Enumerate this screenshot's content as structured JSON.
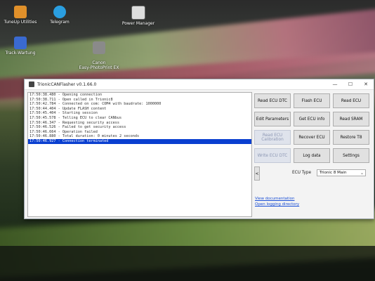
{
  "desktop": {
    "icons": [
      {
        "label": "TuneUp Utilities"
      },
      {
        "label": "Telegram"
      },
      {
        "label": "Power Manager"
      },
      {
        "label": "Track-Wartung"
      },
      {
        "label": "Canon\nEasy-PhotoPrint EX"
      }
    ]
  },
  "window": {
    "title": "TrionicCANFlasher v0.1.66.0",
    "controls": {
      "minimize": "—",
      "maximize": "☐",
      "close": "✕"
    }
  },
  "log": {
    "lines": [
      "17:50:38.480 - Opening connection",
      "17:50:38.711 - Open called in Trionic8",
      "17:50:42.784 - Connected on com: COM4 with baudrate: 1000000",
      "17:50:44.404 - Update FLASH content",
      "17:50:45.404 - Starting session",
      "17:50:45.578 - Telling ECU to clear CANbus",
      "17:50:46.347 - Requesting security access",
      "17:50:46.526 - Failed to get security access",
      "17:50:46.664 - Operation failed",
      "17:50:46.880 - Total duration: 0 minutes 2 seconds",
      "17:50:46.927 - Connection terminated"
    ],
    "selected_index": 10
  },
  "buttons": {
    "read_ecu_dtc": "Read ECU DTC",
    "flash_ecu": "Flash ECU",
    "read_ecu": "Read ECU",
    "edit_parameters": "Edit Parameters",
    "get_ecu_info": "Get ECU info",
    "read_sram": "Read SRAM",
    "read_ecu_calibration": "Read ECU Calibration",
    "recover_ecu": "Recover ECU",
    "restore_t8": "Restore T8",
    "write_ecu_dtc": "Write ECU DTC",
    "log_data": "Log data",
    "settings": "Settings",
    "side": "<"
  },
  "ecu_type": {
    "label": "ECU Type",
    "selected": "Trionic 8 Main"
  },
  "links": {
    "view_documentation": "View documentation",
    "open_logging_directory": "Open logging directory"
  },
  "colors": {
    "selection": "#0a3fd0",
    "link": "#1a4fd6"
  }
}
